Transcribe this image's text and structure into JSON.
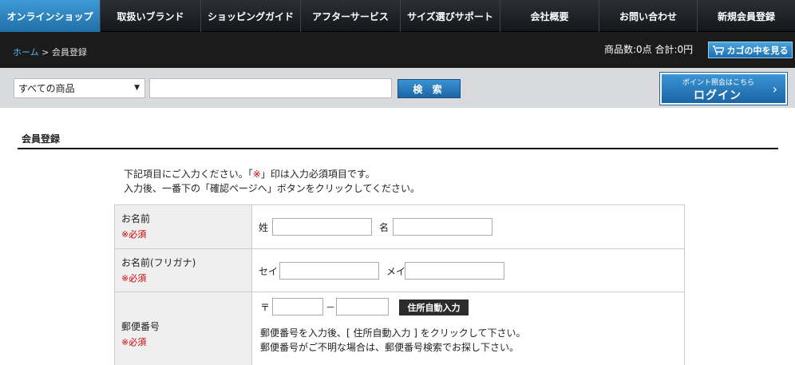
{
  "nav": {
    "items": [
      {
        "label": "オンラインショップ",
        "active": true
      },
      {
        "label": "取扱いブランド"
      },
      {
        "label": "ショッピングガイド"
      },
      {
        "label": "アフターサービス"
      },
      {
        "label": "サイズ選びサポート"
      },
      {
        "label": "会社概要"
      },
      {
        "label": "お問い合わせ"
      },
      {
        "label": "新規会員登録"
      }
    ]
  },
  "breadcrumb": {
    "home": "ホーム",
    "separator": " > ",
    "current": "会員登録"
  },
  "cart": {
    "summary": "商品数:0点 合計:0円",
    "button_label": "カゴの中を見る",
    "icon": "cart-icon"
  },
  "search": {
    "category_selected": "すべての商品",
    "query": "",
    "button_label": "検 索"
  },
  "login": {
    "small_text": "ポイント照会はこちら",
    "label": "ログイン"
  },
  "page": {
    "title": "会員登録",
    "intro_line1_a": "下記項目にご入力ください。「",
    "intro_line1_mark": "※",
    "intro_line1_b": "」印は入力必須項目です。",
    "intro_line2": "入力後、一番下の「確認ページへ」ボタンをクリックしてください。"
  },
  "form": {
    "name": {
      "label": "お名前",
      "required": "※必須",
      "last_label": "姓",
      "first_label": "名",
      "last_value": "",
      "first_value": ""
    },
    "kana": {
      "label": "お名前(フリガナ)",
      "required": "※必須",
      "last_label": "セイ",
      "first_label": "メイ",
      "last_value": "",
      "first_value": ""
    },
    "zip": {
      "label": "郵便番号",
      "required": "※必須",
      "mark": "〒",
      "dash": "－",
      "first_value": "",
      "second_value": "",
      "auto_button": "住所自動入力",
      "note1": "郵便番号を入力後、[ 住所自動入力 ] をクリックして下さい。",
      "note2": "郵便番号がご不明な場合は、郵便番号検索でお探し下さい。"
    }
  },
  "colors": {
    "accent": "#2a7fc1",
    "nav_bg": "#1f2328",
    "required": "#cc0000"
  }
}
